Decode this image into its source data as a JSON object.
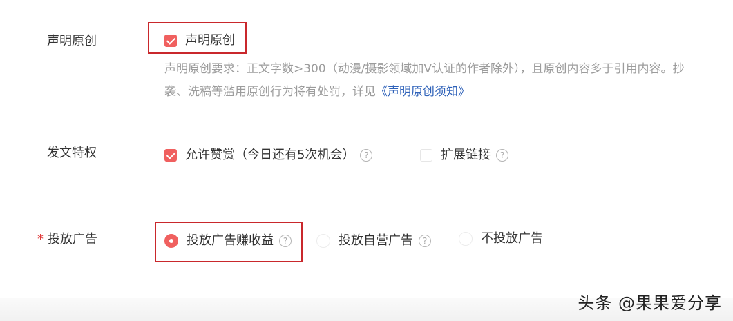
{
  "original": {
    "label": "声明原创",
    "checkbox_label": "声明原创",
    "checked": true,
    "hint_text": "声明原创要求：正文字数>300（动漫/摄影领域加V认证的作者除外），且原创内容多于引用内容。抄袭、洗稿等滥用原创行为将有处罚，详见",
    "hint_link": "《声明原创须知》"
  },
  "privilege": {
    "label": "发文特权",
    "options": [
      {
        "label": "允许赞赏（今日还有5次机会）",
        "checked": true,
        "help_icon": "question-circle-icon"
      },
      {
        "label": "扩展链接",
        "checked": false,
        "help_icon": "question-circle-icon"
      }
    ]
  },
  "ads": {
    "required_mark": "*",
    "label": "投放广告",
    "options": [
      {
        "label": "投放广告赚收益",
        "selected": true,
        "help_icon": "question-circle-icon"
      },
      {
        "label": "投放自营广告",
        "selected": false,
        "help_icon": "question-circle-icon"
      },
      {
        "label": "不投放广告",
        "selected": false
      }
    ]
  },
  "help_glyph": "?",
  "watermark": "头条 @果果爱分享",
  "colors": {
    "accent": "#f0605f",
    "highlight_border": "#c9282c",
    "link": "#2f62b9",
    "hint": "#9c9c9c"
  }
}
